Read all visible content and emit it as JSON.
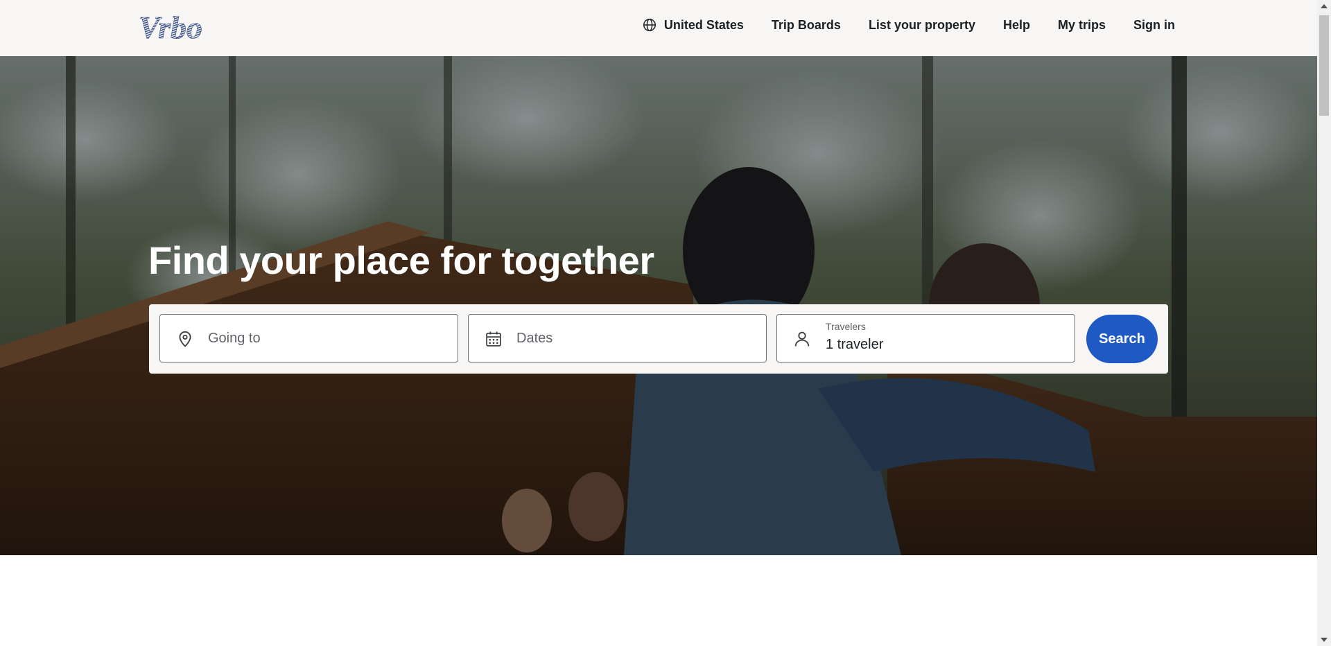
{
  "header": {
    "logo_text": "Vrbo",
    "nav": [
      {
        "label": "United States",
        "icon": "globe-icon"
      },
      {
        "label": "Trip Boards"
      },
      {
        "label": "List your property"
      },
      {
        "label": "Help"
      },
      {
        "label": "My trips"
      },
      {
        "label": "Sign in"
      }
    ]
  },
  "hero": {
    "title": "Find your place for together",
    "search": {
      "destination": {
        "placeholder": "Going to",
        "icon": "location-pin-icon"
      },
      "dates": {
        "placeholder": "Dates",
        "icon": "calendar-icon"
      },
      "travelers": {
        "label": "Travelers",
        "value": "1 traveler",
        "icon": "person-icon"
      },
      "button_label": "Search"
    }
  },
  "colors": {
    "header_bg": "#f7f6f4",
    "brand_logo": "#3e5589",
    "search_button": "#1f5ac4",
    "text_dark": "#1b2024"
  }
}
